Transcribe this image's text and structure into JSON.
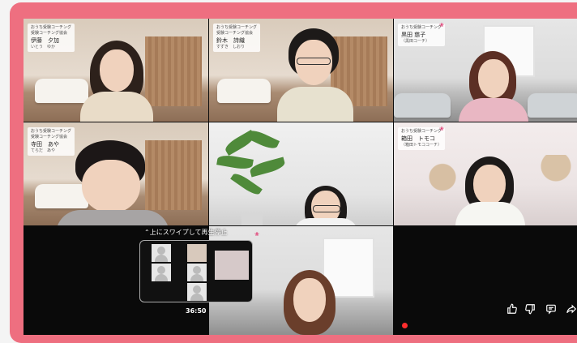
{
  "participants": [
    {
      "org1": "おうち受験コーチング",
      "org2": "受験コーチング協会",
      "name": "伊藤　夕加",
      "kana": "いとう　ゆか"
    },
    {
      "org1": "おうち受験コーチング",
      "org2": "受験コーチング協会",
      "name": "鈴木　詩織",
      "kana": "すずき　しおり"
    },
    {
      "org1": "おうち受験コーチング",
      "org2": "",
      "name": "黒田 慈子",
      "kana": "（黒田コーチ）"
    },
    {
      "org1": "おうち受験コーチング",
      "org2": "受験コーチング協会",
      "name": "寺田　あや",
      "kana": "てらだ　あや"
    },
    {
      "org1": "おうち受験コーチング",
      "org2": "",
      "name": "箱田　トモコ",
      "kana": "（箱田トモココーチ）"
    }
  ],
  "overlay": {
    "swipe_hint": "⌃上にスワイプして再生停止",
    "pip_time": "36:50"
  },
  "actions": {
    "like_icon": "thumbs-up-icon",
    "dislike_icon": "thumbs-down-icon",
    "comment_icon": "comment-icon",
    "share_icon": "share-icon"
  },
  "colors": {
    "frame": "#ee6f80",
    "progress": "#ff2d2d"
  }
}
